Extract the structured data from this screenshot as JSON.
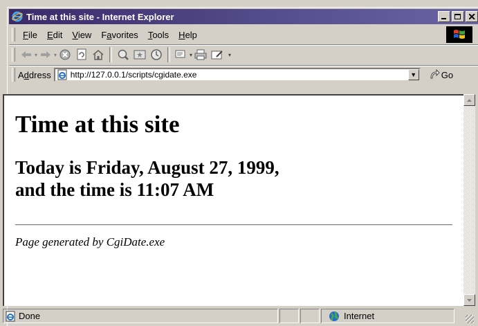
{
  "window": {
    "title": "Time at this site - Internet Explorer"
  },
  "menu": {
    "items": [
      "File",
      "Edit",
      "View",
      "Favorites",
      "Tools",
      "Help"
    ],
    "accel": [
      "F",
      "E",
      "V",
      "a",
      "T",
      "H"
    ]
  },
  "address": {
    "label": "Address",
    "url": "http://127.0.0.1/scripts/cgidate.exe",
    "go_label": "Go"
  },
  "page": {
    "heading": "Time at this site",
    "line1": "Today is Friday, August 27, 1999,",
    "line2": "and the time is 11:07 AM",
    "footer": "Page generated by CgiDate.exe"
  },
  "status": {
    "text": "Done",
    "zone": "Internet"
  },
  "icons": {
    "toolbar": [
      "back-icon",
      "forward-icon",
      "stop-icon",
      "refresh-icon",
      "home-icon",
      "search-icon",
      "favorites-icon",
      "history-icon",
      "mail-icon",
      "print-icon",
      "edit-icon"
    ]
  }
}
